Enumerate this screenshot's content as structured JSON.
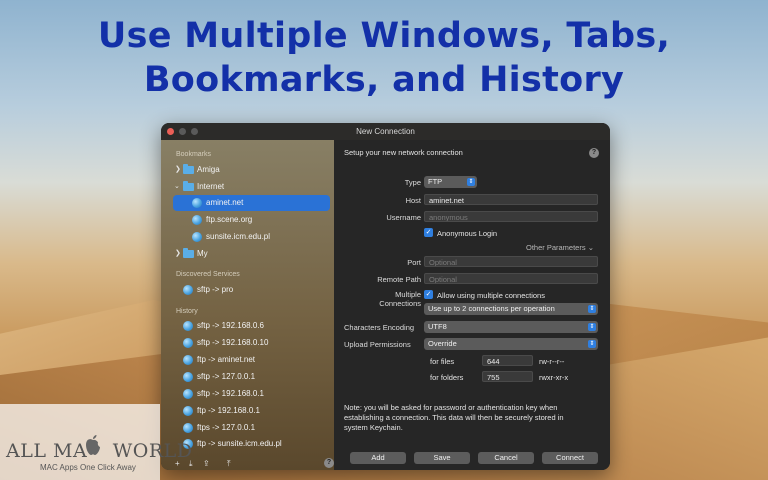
{
  "headline": {
    "line1": "Use Multiple Windows, Tabs,",
    "line2": "Bookmarks, and History"
  },
  "window": {
    "title": "New Connection"
  },
  "sidebar": {
    "bookmarks_header": "Bookmarks",
    "bookmarks": [
      {
        "label": "Amiga",
        "type": "folder",
        "expanded": false
      },
      {
        "label": "Internet",
        "type": "folder",
        "expanded": true
      },
      {
        "label": "aminet.net",
        "type": "server",
        "selected": true
      },
      {
        "label": "ftp.scene.org",
        "type": "server"
      },
      {
        "label": "sunsite.icm.edu.pl",
        "type": "server"
      },
      {
        "label": "My",
        "type": "folder",
        "expanded": false
      }
    ],
    "discovered_header": "Discovered Services",
    "discovered": [
      {
        "label": "sftp -> pro"
      }
    ],
    "history_header": "History",
    "history": [
      {
        "label": "sftp -> 192.168.0.6"
      },
      {
        "label": "sftp -> 192.168.0.10"
      },
      {
        "label": "ftp -> aminet.net"
      },
      {
        "label": "sftp -> 127.0.0.1"
      },
      {
        "label": "sftp -> 192.168.0.1"
      },
      {
        "label": "ftp -> 192.168.0.1"
      },
      {
        "label": "ftps -> 127.0.0.1"
      },
      {
        "label": "ftp -> sunsite.icm.edu.pl"
      }
    ]
  },
  "form": {
    "heading": "Setup your new network connection",
    "type_label": "Type",
    "type_value": "FTP",
    "host_label": "Host",
    "host_value": "aminet.net",
    "username_label": "Username",
    "username_placeholder": "anonymous",
    "anonymous_login_label": "Anonymous Login",
    "anonymous_login_checked": true,
    "other_params_label": "Other Parameters",
    "port_label": "Port",
    "port_placeholder": "Optional",
    "remote_path_label": "Remote Path",
    "remote_path_placeholder": "Optional",
    "multiple_label_1": "Multiple",
    "multiple_label_2": "Connections",
    "multiple_checkbox_label": "Allow using multiple connections",
    "multiple_checked": true,
    "multiple_value": "Use up to 2 connections per operation",
    "encoding_label": "Characters Encoding",
    "encoding_value": "UTF8",
    "upload_perm_label": "Upload Permissions",
    "upload_perm_value": "Override",
    "files_label": "for files",
    "files_value": "644",
    "files_perm": "rw-r--r--",
    "folders_label": "for folders",
    "folders_value": "755",
    "folders_perm": "rwxr-xr-x",
    "note_line1": "Note: you will be asked for password or authentication key when",
    "note_line2": "establishing a connection. This data will then be securely stored in",
    "note_line3": "system Keychain."
  },
  "buttons": {
    "add": "Add",
    "save": "Save",
    "cancel": "Cancel",
    "connect": "Connect"
  },
  "help_glyph": "?",
  "watermark": {
    "title_left": "ALL MA",
    "title_right": " WORLD",
    "subtitle": "MAC Apps One Click Away"
  }
}
